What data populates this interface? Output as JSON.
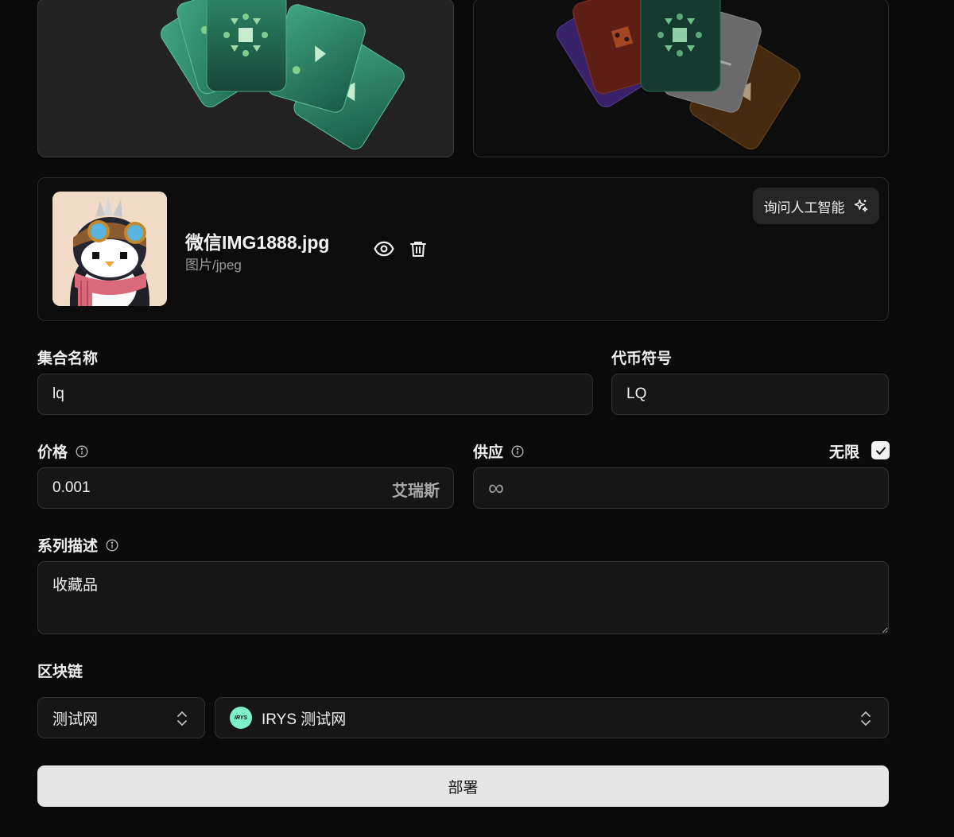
{
  "upload": {
    "file_name": "微信IMG1888.jpg",
    "file_type": "图片/jpeg",
    "ai_button_label": "询问人工智能"
  },
  "collection_name": {
    "label": "集合名称",
    "value": "lq"
  },
  "token_symbol": {
    "label": "代币符号",
    "value": "LQ"
  },
  "price": {
    "label": "价格",
    "value": "0.001",
    "currency": "艾瑞斯"
  },
  "supply": {
    "label": "供应",
    "value": "∞",
    "unlimited_label": "无限",
    "unlimited_checked": true
  },
  "description": {
    "label": "系列描述",
    "value": "收藏品"
  },
  "blockchain": {
    "label": "区块链",
    "network": "测试网",
    "chain": "IRYS 测试网",
    "chain_logo_text": "IRYS"
  },
  "deploy_label": "部署",
  "colors": {
    "background": "#0a0a0a",
    "card_green": "#2f8a6b",
    "accent_irys": "#7ef0c8",
    "button_primary": "#e6e6e6"
  }
}
